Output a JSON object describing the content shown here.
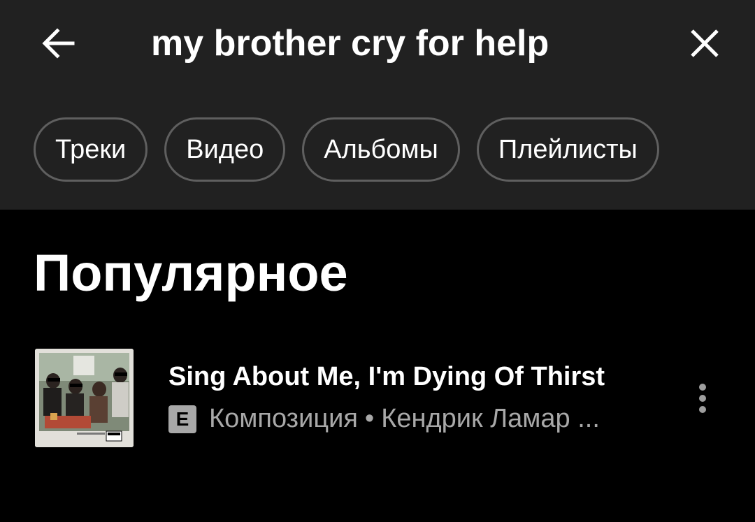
{
  "header": {
    "back_icon": "arrow-left-icon",
    "query": "my brother cry for help",
    "clear_icon": "close-icon",
    "background_color": "#212121"
  },
  "filters": [
    {
      "label": "Треки"
    },
    {
      "label": "Видео"
    },
    {
      "label": "Альбомы"
    },
    {
      "label": "Плейлисты"
    }
  ],
  "results": {
    "section_title": "Популярное",
    "items": [
      {
        "title": "Sing About Me, I'm Dying Of Thirst",
        "explicit_badge": "E",
        "type": "Композиция",
        "separator": "•",
        "artist": "Кендрик Ламар ...",
        "menu_icon": "more-vertical-icon"
      }
    ]
  }
}
